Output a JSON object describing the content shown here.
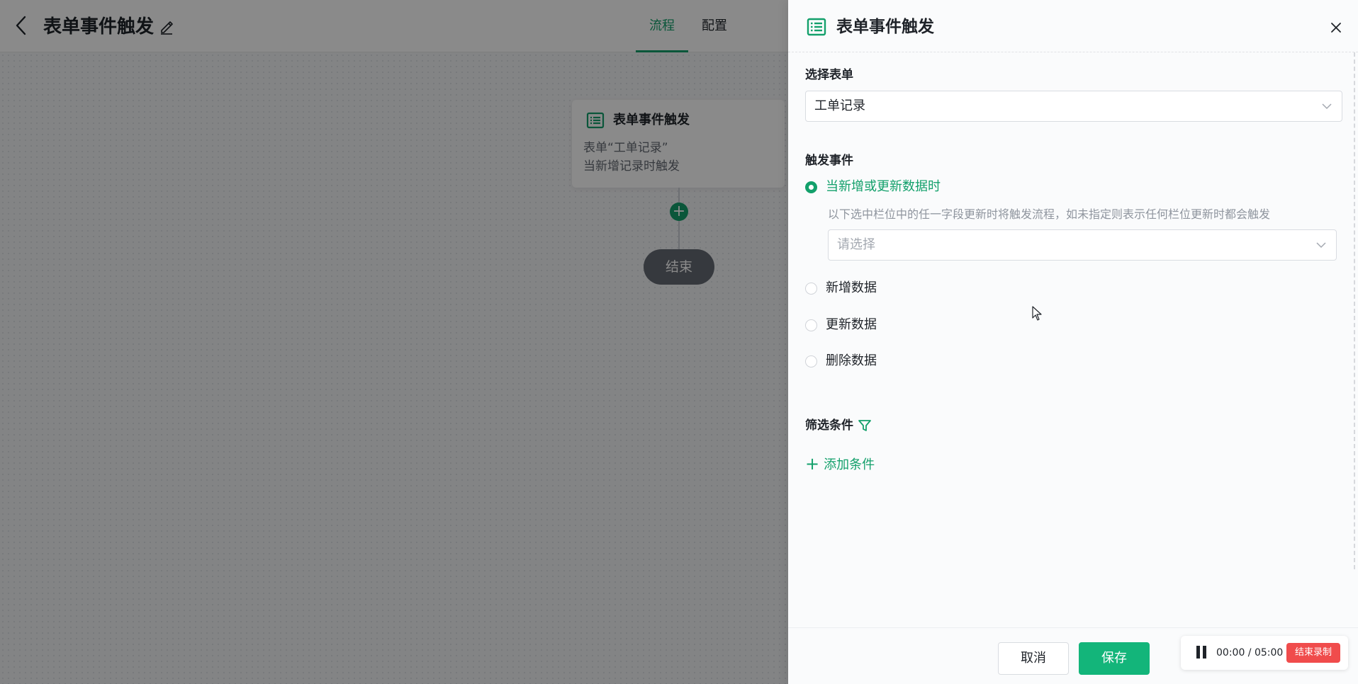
{
  "app": {
    "title": "表单事件触发",
    "tabs": [
      {
        "label": "流程",
        "active": true
      },
      {
        "label": "配置",
        "active": false
      }
    ]
  },
  "canvas": {
    "trigger_node": {
      "title": "表单事件触发",
      "desc_line1": "表单“工单记录”",
      "desc_line2": "当新增记录时触发"
    },
    "end_node": {
      "label": "结束"
    }
  },
  "drawer": {
    "title": "表单事件触发",
    "select_form": {
      "label": "选择表单",
      "value": "工单记录"
    },
    "trigger_event": {
      "label": "触发事件",
      "options": [
        {
          "label": "当新增或更新数据时",
          "checked": true
        },
        {
          "label": "新增数据",
          "checked": false
        },
        {
          "label": "更新数据",
          "checked": false
        },
        {
          "label": "删除数据",
          "checked": false
        }
      ],
      "hint": "以下选中栏位中的任一字段更新时将触发流程，如未指定则表示任何栏位更新时都会触发",
      "field_select_placeholder": "请选择"
    },
    "filter": {
      "label": "筛选条件",
      "add_label": "添加条件"
    },
    "footer": {
      "cancel_label": "取消",
      "save_label": "保存"
    }
  },
  "recorder": {
    "time": "00:00 / 05:00",
    "stop_label": "结束录制"
  },
  "colors": {
    "accent": "#13a06b",
    "save_button": "#13b57a",
    "record_stop": "#f04c4c",
    "end_node": "#646a73"
  }
}
